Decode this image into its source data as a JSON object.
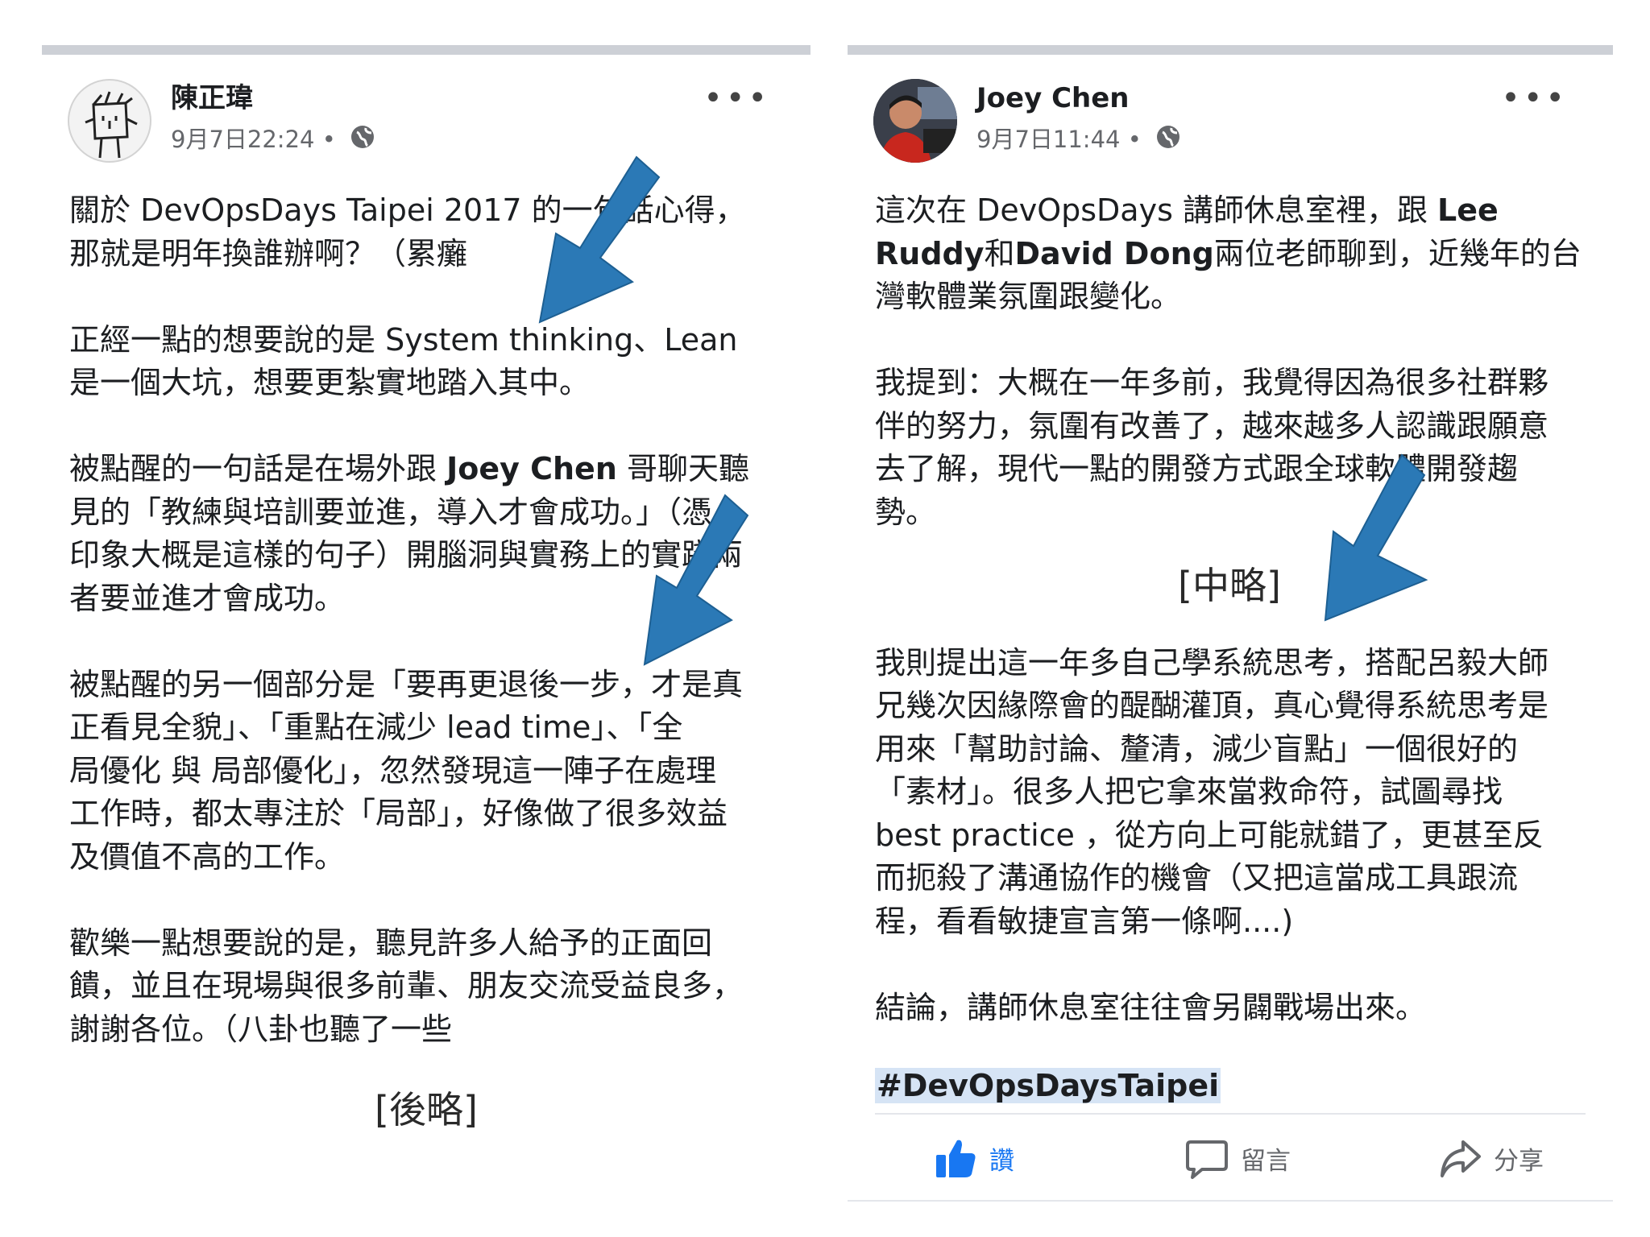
{
  "left_post": {
    "author": "陳正瑋",
    "timestamp": "9月7日22:24",
    "privacy_sep": "•",
    "more": "•••",
    "paragraphs": [
      [
        "關於 DevOpsDays Taipei 2017 的一句話心得，",
        "那就是明年換誰辦啊？（累癱"
      ],
      [
        "正經一點的想要說的是 System thinking、Lean",
        "是一個大坑，想要更紮實地踏入其中。"
      ],
      [
        "被點醒的一句話是在場外跟 ",
        "Joey Chen",
        " 哥聊天聽",
        "見的「教練與培訓要並進，導入才會成功。」（憑",
        "印象大概是這樣的句子）開腦洞與實務上的實踐兩",
        "者要並進才會成功。"
      ],
      [
        "被點醒的另一個部分是「要再更退後一步，才是真",
        "正看見全貌」、「重點在減少 lead time」、「全",
        "局優化 與 局部優化」，忽然發現這一陣子在處理",
        "工作時，都太專注於「局部」，好像做了很多效益",
        "及價值不高的工作。"
      ],
      [
        "歡樂一點想要說的是，聽見許多人給予的正面回",
        "饋，並且在現場與很多前輩、朋友交流受益良多，",
        "謝謝各位。（八卦也聽了一些"
      ]
    ],
    "elided": "[後略]"
  },
  "right_post": {
    "author": "Joey Chen",
    "timestamp": "9月7日11:44",
    "privacy_sep": "•",
    "more": "•••",
    "p1": [
      "這次在 DevOpsDays 講師休息室裡，跟 ",
      "Lee",
      "Ruddy",
      "和",
      "David Dong",
      "兩位老師聊到，近幾年的台",
      "灣軟體業氛圍跟變化。"
    ],
    "p2": [
      "我提到：大概在一年多前，我覺得因為很多社群夥",
      "伴的努力，氛圍有改善了，越來越多人認識跟願意",
      "去了解，現代一點的開發方式跟全球軟體開發趨",
      "勢。"
    ],
    "elided": "[中略]",
    "p3": [
      "我則提出這一年多自己學系統思考，搭配呂毅大師",
      "兄幾次因緣際會的醍醐灌頂，真心覺得系統思考是",
      "用來「幫助討論、釐清，減少盲點」一個很好的",
      "「素材」。很多人把它拿來當救命符，試圖尋找",
      "best practice ，從方向上可能就錯了，更甚至反",
      "而扼殺了溝通協作的機會（又把這當成工具跟流",
      "程，看看敏捷宣言第一條啊....)"
    ],
    "p4": "結論，講師休息室往往會另闢戰場出來。",
    "hashtag": "#DevOpsDaysTaipei",
    "actions": {
      "like": "讚",
      "comment": "留言",
      "share": "分享"
    }
  },
  "colors": {
    "arrow": "#2b79b6",
    "like": "#1877f2",
    "meta": "#65676b"
  }
}
